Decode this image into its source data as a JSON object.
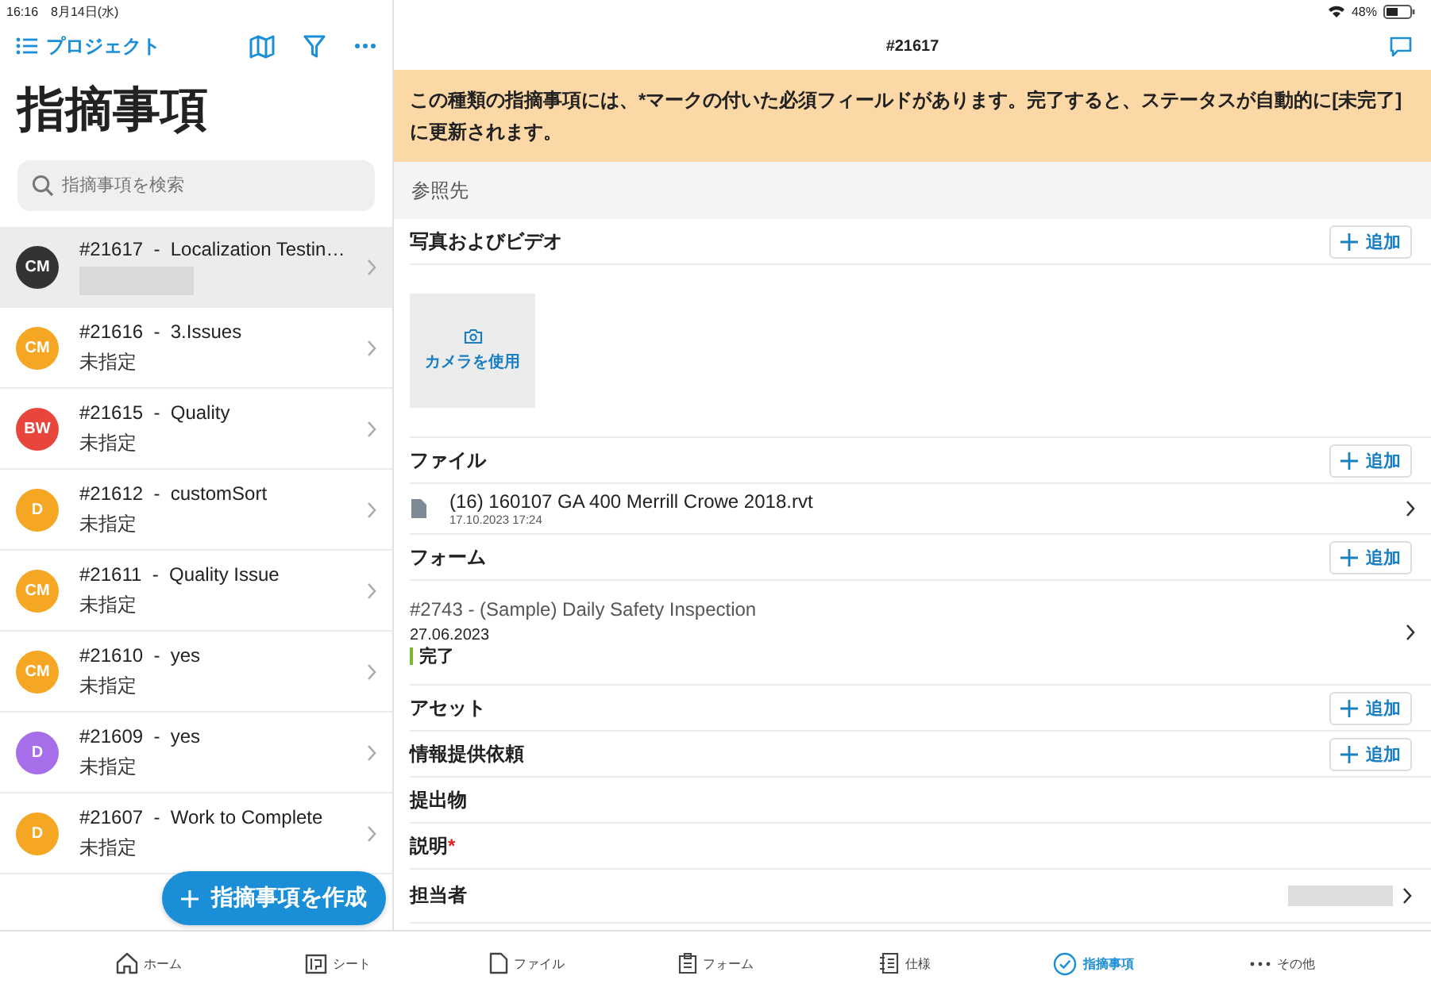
{
  "status_bar": {
    "time": "16:16",
    "date": "8月14日(水)",
    "battery": "48%"
  },
  "sidebar": {
    "back_link": "プロジェクト",
    "title": "指摘事項",
    "search": {
      "placeholder": "指摘事項を検索"
    },
    "issues": [
      {
        "label": "#21617  -  Localization Testin…",
        "initials": "CM",
        "color": "#333333",
        "selected": true
      },
      {
        "label": "#21616  -  3.Issues",
        "subtitle": "未指定",
        "initials": "CM",
        "color": "#f5a623",
        "selected": false
      },
      {
        "label": "#21615  -  Quality",
        "subtitle": "未指定",
        "initials": "BW",
        "color": "#e8453c",
        "selected": false
      },
      {
        "label": "#21612  -  customSort",
        "subtitle": "未指定",
        "initials": "D",
        "color": "#f5a623",
        "selected": false
      },
      {
        "label": "#21611  -  Quality Issue",
        "subtitle": "未指定",
        "initials": "CM",
        "color": "#f5a623",
        "selected": false
      },
      {
        "label": "#21610  -  yes",
        "subtitle": "未指定",
        "initials": "CM",
        "color": "#f5a623",
        "selected": false
      },
      {
        "label": "#21609  -  yes",
        "subtitle": "未指定",
        "initials": "D",
        "color": "#a66ee8",
        "selected": false
      },
      {
        "label": "#21607  -  Work to Complete",
        "subtitle": "未指定",
        "initials": "D",
        "color": "#f5a623",
        "selected": false
      }
    ],
    "create_button": "指摘事項を作成"
  },
  "detail": {
    "title": "#21617",
    "banner": "この種類の指摘事項には、*マークの付いた必須フィールドがあります。完了すると、ステータスが自動的に[未完了]に更新されます。",
    "reference_header": "参照先",
    "sections": [
      {
        "kind": "header",
        "label": "写真およびビデオ",
        "add_button": "追加"
      },
      {
        "kind": "camera",
        "label": "カメラを使用"
      },
      {
        "kind": "header",
        "label": "ファイル",
        "add_button": "追加"
      },
      {
        "kind": "file",
        "name": "(16) 160107 GA 400 Merrill Crowe 2018.rvt",
        "date": "17.10.2023 17:24"
      },
      {
        "kind": "header",
        "label": "フォーム",
        "add_button": "追加"
      },
      {
        "kind": "form",
        "title": "#2743 - (Sample) Daily Safety Inspection",
        "date": "27.06.2023",
        "status": "完了",
        "color": "#7cb82f"
      },
      {
        "kind": "header",
        "label": "アセット",
        "add_button": "追加"
      },
      {
        "kind": "header",
        "label": "情報提供依頼",
        "add_button": "追加"
      },
      {
        "kind": "header",
        "label": "提出物"
      },
      {
        "kind": "header",
        "label": "説明",
        "required_mark": "*"
      },
      {
        "kind": "assignee",
        "label": "担当者"
      }
    ]
  },
  "tabs": [
    {
      "label": "ホーム",
      "selected": false
    },
    {
      "label": "シート",
      "selected": false
    },
    {
      "label": "ファイル",
      "selected": false
    },
    {
      "label": "フォーム",
      "selected": false
    },
    {
      "label": "仕様",
      "selected": false
    },
    {
      "label": "指摘事項",
      "selected": true
    },
    {
      "label": "その他",
      "selected": false
    }
  ]
}
